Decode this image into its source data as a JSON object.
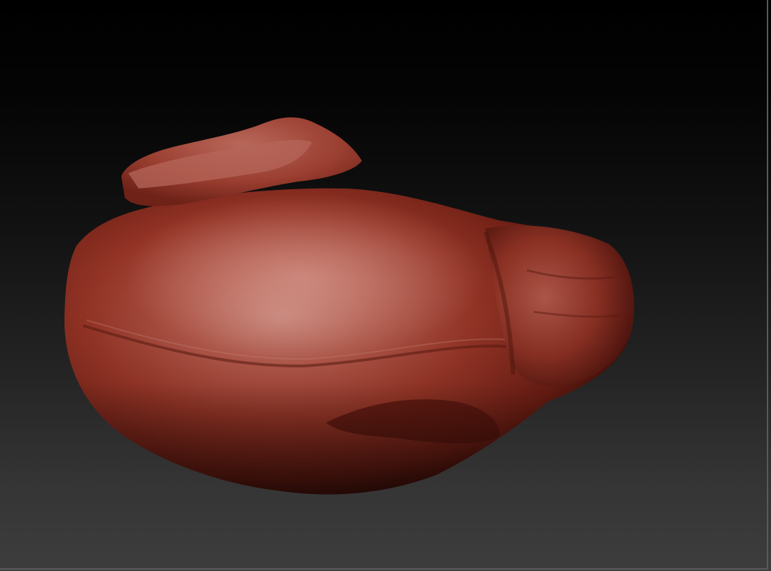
{
  "app": {
    "view": "3d-sculpt-viewport",
    "material_color": "#9b3a2c",
    "background_top": "#000000",
    "background_bottom": "#3d3d3d"
  },
  "viewport": {
    "model": {
      "icon": "sculpted-rock-mesh",
      "material": "red-wax"
    }
  }
}
